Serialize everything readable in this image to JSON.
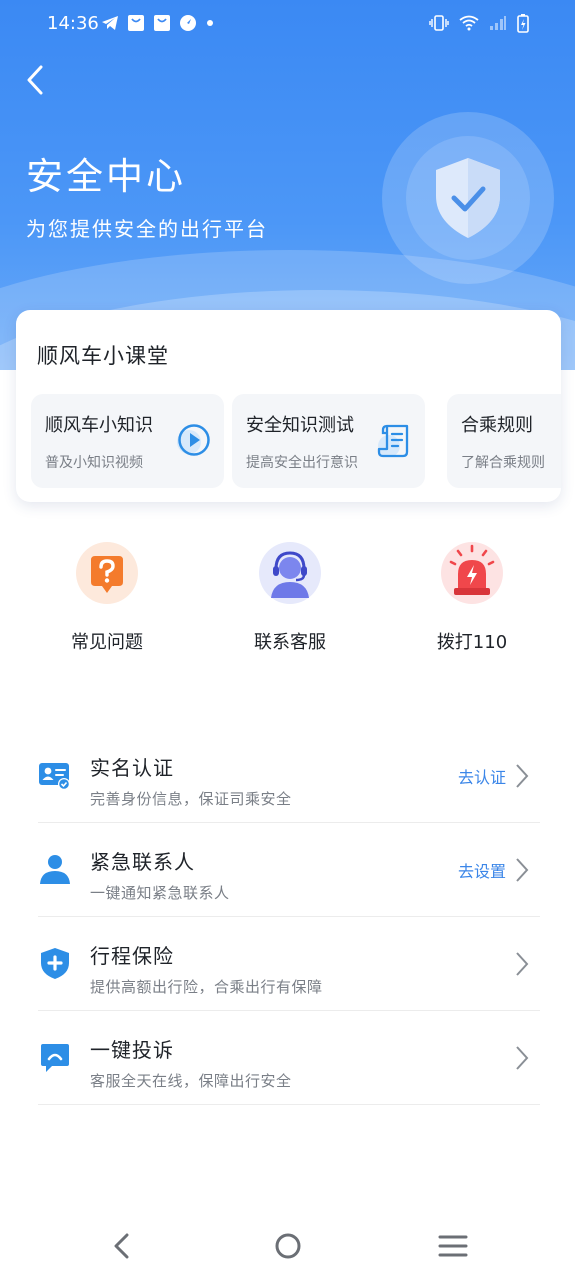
{
  "status_bar": {
    "time": "14:36",
    "left_icons": [
      "telegram-icon",
      "shopping-bag-icon",
      "shopping-bag-icon",
      "compass-icon",
      "dot-icon"
    ],
    "right_icons": [
      "vibrate-icon",
      "wifi-icon",
      "signal-icon",
      "battery-charging-icon"
    ]
  },
  "header": {
    "back_icon": "chevron-left-icon",
    "title": "安全中心",
    "subtitle": "为您提供安全的出行平台",
    "illustration": "shield-check-icon"
  },
  "classroom": {
    "title": "顺风车小课堂",
    "lessons": [
      {
        "title": "顺风车小知识",
        "subtitle": "普及小知识视频",
        "icon": "play-icon"
      },
      {
        "title": "安全知识测试",
        "subtitle": "提高安全出行意识",
        "icon": "scroll-icon"
      },
      {
        "title": "合乘规则",
        "subtitle": "了解合乘规则",
        "icon": ""
      }
    ]
  },
  "quick_actions": [
    {
      "label": "常见问题",
      "icon": "question-bubble-icon"
    },
    {
      "label": "联系客服",
      "icon": "customer-service-icon"
    },
    {
      "label": "拨打110",
      "icon": "alarm-light-icon"
    }
  ],
  "settings": [
    {
      "title": "实名认证",
      "subtitle": "完善身份信息，保证司乘安全",
      "action": "去认证",
      "icon": "id-card-icon"
    },
    {
      "title": "紧急联系人",
      "subtitle": "一键通知紧急联系人",
      "action": "去设置",
      "icon": "person-icon"
    },
    {
      "title": "行程保险",
      "subtitle": "提供高额出行险，合乘出行有保障",
      "action": "",
      "icon": "shield-plus-icon"
    },
    {
      "title": "一键投诉",
      "subtitle": "客服全天在线，保障出行安全",
      "action": "",
      "icon": "complaint-chat-icon"
    }
  ],
  "nav_bar": [
    "back-nav-icon",
    "home-nav-icon",
    "menu-nav-icon"
  ],
  "colors": {
    "primary": "#3b89f3",
    "action_text": "#3b86e8",
    "alarm_red": "#f0474b",
    "question_orange": "#f47b2c"
  }
}
